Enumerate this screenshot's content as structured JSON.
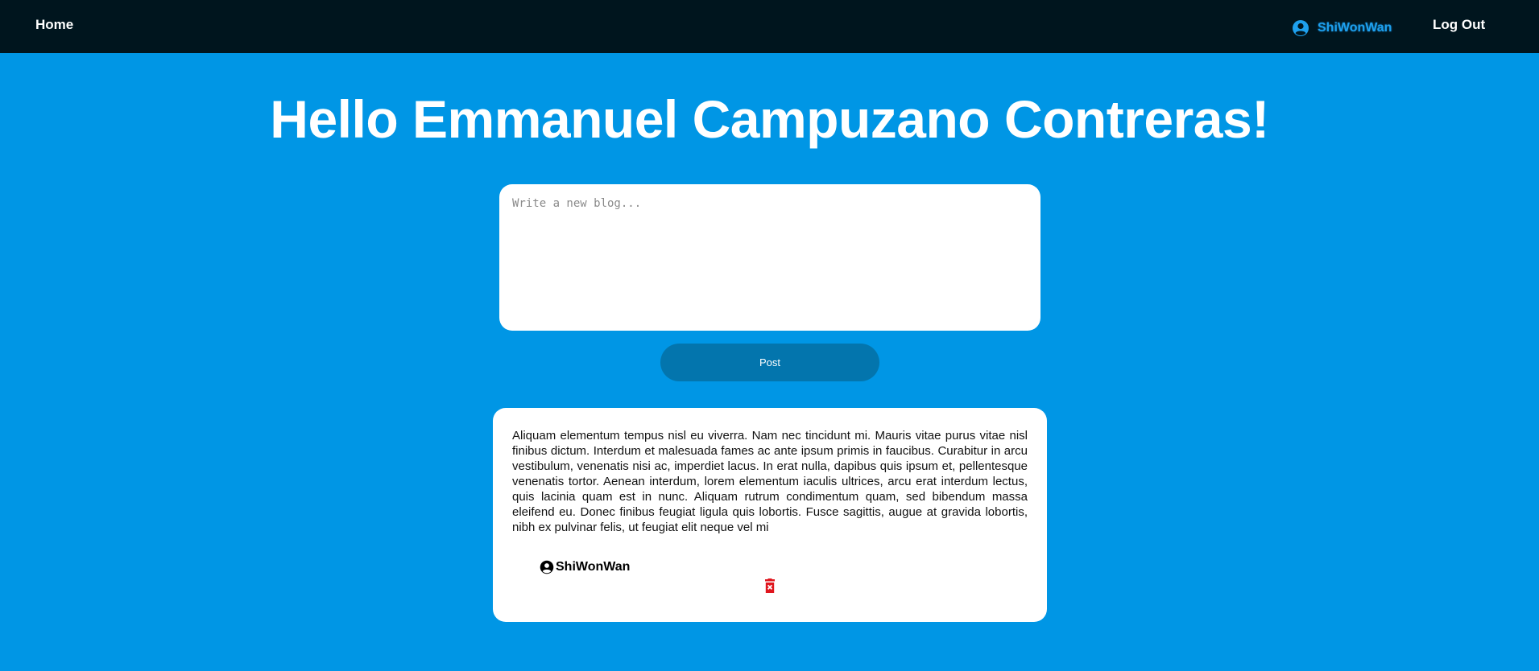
{
  "nav": {
    "home_label": "Home",
    "username": "ShiWonWan",
    "logout_label": "Log Out"
  },
  "main": {
    "greeting": "Hello Emmanuel Campuzano Contreras!",
    "composer_placeholder": "Write a new blog...",
    "post_label": "Post"
  },
  "blogs": [
    {
      "text": "Aliquam elementum tempus nisl eu viverra. Nam nec tincidunt mi. Mauris vitae purus vitae nisl finibus dictum. Interdum et malesuada fames ac ante ipsum primis in faucibus. Curabitur in arcu vestibulum, venenatis nisi ac, imperdiet lacus. In erat nulla, dapibus quis ipsum et, pellentesque venenatis tortor. Aenean interdum, lorem elementum iaculis ultrices, arcu erat interdum lectus, quis lacinia quam est in nunc. Aliquam rutrum condimentum quam, sed bibendum massa eleifend eu. Donec finibus feugiat ligula quis lobortis. Fusce sagittis, augue at gravida lobortis, nibh ex pulvinar felis, ut feugiat elit neque vel mi",
      "author": "ShiWonWan"
    }
  ],
  "icons": {
    "user": "user-circle-icon",
    "delete": "trash-icon"
  },
  "colors": {
    "background": "#0096e5",
    "navbar": "#00151e",
    "username": "#1ea0ee",
    "post_button": "#0375ad",
    "delete_icon": "#e0161e"
  }
}
